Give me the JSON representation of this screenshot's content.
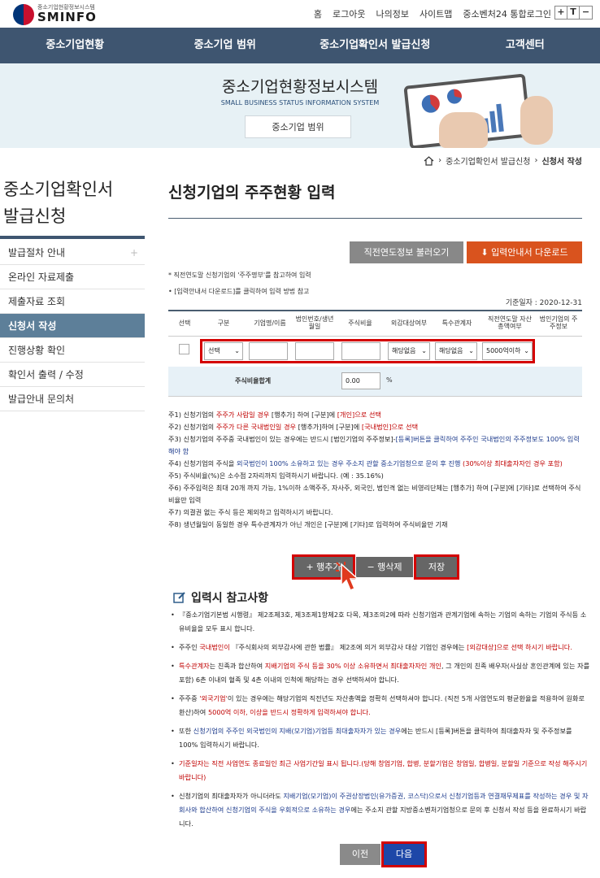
{
  "header": {
    "logo_sub": "중소기업현황정보시스템",
    "logo_main": "SMINFO",
    "links": [
      "홈",
      "로그아웃",
      "나의정보",
      "사이트맵",
      "중소벤처24 통합로그인"
    ],
    "font_buttons": [
      "+",
      "T",
      "−"
    ]
  },
  "gnb": [
    "중소기업현황",
    "중소기업 범위",
    "중소기업확인서 발급신청",
    "고객센터"
  ],
  "banner": {
    "title": "중소기업현황정보시스템",
    "subtitle": "SMALL BUSINESS STATUS INFORMATION SYSTEM",
    "button": "중소기업 범위"
  },
  "breadcrumb": [
    "중소기업확인서 발급신청",
    "신청서 작성"
  ],
  "sidebar": {
    "title_line1": "중소기업확인서",
    "title_line2": "발급신청",
    "items": [
      {
        "label": "발급절차 안내",
        "plus": "+"
      },
      {
        "label": "온라인 자료제출"
      },
      {
        "label": "제출자료 조회"
      },
      {
        "label": "신청서 작성"
      },
      {
        "label": "진행상황 확인"
      },
      {
        "label": "확인서 출력 / 수정"
      },
      {
        "label": "발급안내 문의처"
      }
    ]
  },
  "content": {
    "title": "신청기업의 주주현황 입력",
    "btn_prev_year": "직전연도정보 불러오기",
    "btn_download": "입력안내서 다운로드",
    "note1": "* 직전연도말 신청기업의 '주주명부'를 참고하여 입력",
    "note2": "[입력안내서 다운로드]를 클릭하여 입력 방법 참고",
    "base_date": "기준일자 : 2020-12-31"
  },
  "table": {
    "headers": [
      "선택",
      "구분",
      "기업명/이름",
      "법인번호/생년월일",
      "주식비율",
      "외감대상여부",
      "특수관계자",
      "직전연도말 자산총액여부",
      "법인기업의 주주정보"
    ],
    "row": {
      "type": "선택",
      "audit": "해당없음",
      "related": "해당없음",
      "assets": "5000억이하"
    },
    "sum_label": "주식비율합계",
    "sum_value": "0.00",
    "sum_unit": "%"
  },
  "notes": {
    "n1a": "주1) 신청기업의 ",
    "n1b": "주주가 사람일 경우",
    "n1c": " [행추가] 하여 [구분]에 ",
    "n1d": "[개인]으로 선택",
    "n2a": "주2) 신청기업의 ",
    "n2b": "주주가 다른 국내법인일 경우",
    "n2c": " [행추가]하여 [구분]에 ",
    "n2d": "[국내법인]으로 선택",
    "n3a": "주3) 신청기업의 주주중 국내법인이 있는 경우에는 반드시 [법인기업의 주주정보]-",
    "n3b": "[등록]버튼을 클릭하여 주주인 국내법인의 주주정보도 100% 입력해야 함",
    "n4a": "주4) 신청기업의 주식을 ",
    "n4b": "외국법인이 100% 소유하고 있는 경우 주소지 관할 중소기업청으로 문의 후 진행",
    "n4c": " (30%이상 최대출자자인 경우 포함)",
    "n5": "주5) 주식비율(%)은 소수점 2자리까지 입력하시기 바랍니다. (예 : 35.16%)",
    "n6": "주6) 주주입력은 최대 20개 까지 가능, 1%이하 소액주주, 자사주, 외국인, 법인격 없는 비영리단체는 [행추가] 하여 [구분]에 [기타]로 선택하여 주식비율만 입력",
    "n7": "주7) 의결권 없는 주식 등은 제외하고 입력하시기 바랍니다.",
    "n8": "주8) 생년월일이 동일한 경우 특수관계자가 아닌 개인은 [구분]에 [기타]로 입력하여 주식비율만 기재"
  },
  "row_buttons": {
    "add": "+ 행추가",
    "delete": "− 행삭제",
    "save": "저장"
  },
  "reference": {
    "title": "입력시 참고사항",
    "r1": "『중소기업기본법 시행령』 제2조제3호, 제3조제1항제2호 다목, 제3조의2에 따라 신청기업과 관계기업에 속하는 기업의 속하는 기업의 주식등 소유비율을 모두 표시 합니다.",
    "r2a": "주주인 ",
    "r2b": "국내법인이",
    "r2c": " 『주식회사의 외부감사에 관한 법률』 제2조에 의거 외부감사 대상 기업인 경우에는 ",
    "r2d": "[외감대상]으로 선택 하시기 바랍니다.",
    "r3a": "특수관계자",
    "r3b": "는 친족과 합산하여 ",
    "r3c": "지배기업의 주식 등을 30% 이상 소유하면서 최대출자자인 개인",
    "r3d": ", 그 개인의 친족 배우자(사실상 혼인관계에 있는 자를 포함) 6촌 이내의 혈족 및 4촌 이내의 인척에 해당하는 경우 선택하셔야 합니다.",
    "r4a": "주주중 ",
    "r4b": "'외국기업'",
    "r4c": "이 있는 경우에는 해당기업의 직전년도 자산총액을 정확히 선택하셔야 합니다. (직전 5개 사업연도의 평균환율을 적용하여 원화로 환산)하여 ",
    "r4d": "5000억 이하, 이상을 반드시 정확하게 입력하셔야 합니다.",
    "r5a": "또한 ",
    "r5b": "신청기업의 주주인 외국법인의 지배(모기업)기업등 최대출자자가 있는 경우",
    "r5c": "에는 반드시 [등록]버튼을 클릭하여 최대출자자 및 주주정보를 100% 입력하시기 바랍니다.",
    "r6a": "기준일자",
    "r6b": "는 직전 사업연도 종료일인 최근 사업기간일 표시 됩니다.(당해 창업기업, 합병, 분할기업은 창업일, 합병일, 분할일 기준으로 작성 해주시기 바랍니다)",
    "r7a": "신청기업의 최대출자자가 아니더라도 ",
    "r7b": "지배기업(모기업)이 주권상장법인(유가증권, 코스닥)으로서 신청기업등과 연결재무제표를 작성하는 경우 및 자회사와 합산하여 신청기업의 주식을 우회적으로 소유하는 경우",
    "r7c": "에는 주소지 관할 지방중소벤처기업청으로 문의 후 신청서 작성 등을 완료하시기 바랍니다."
  },
  "nav_buttons": {
    "back": "이전",
    "next": "다음"
  }
}
